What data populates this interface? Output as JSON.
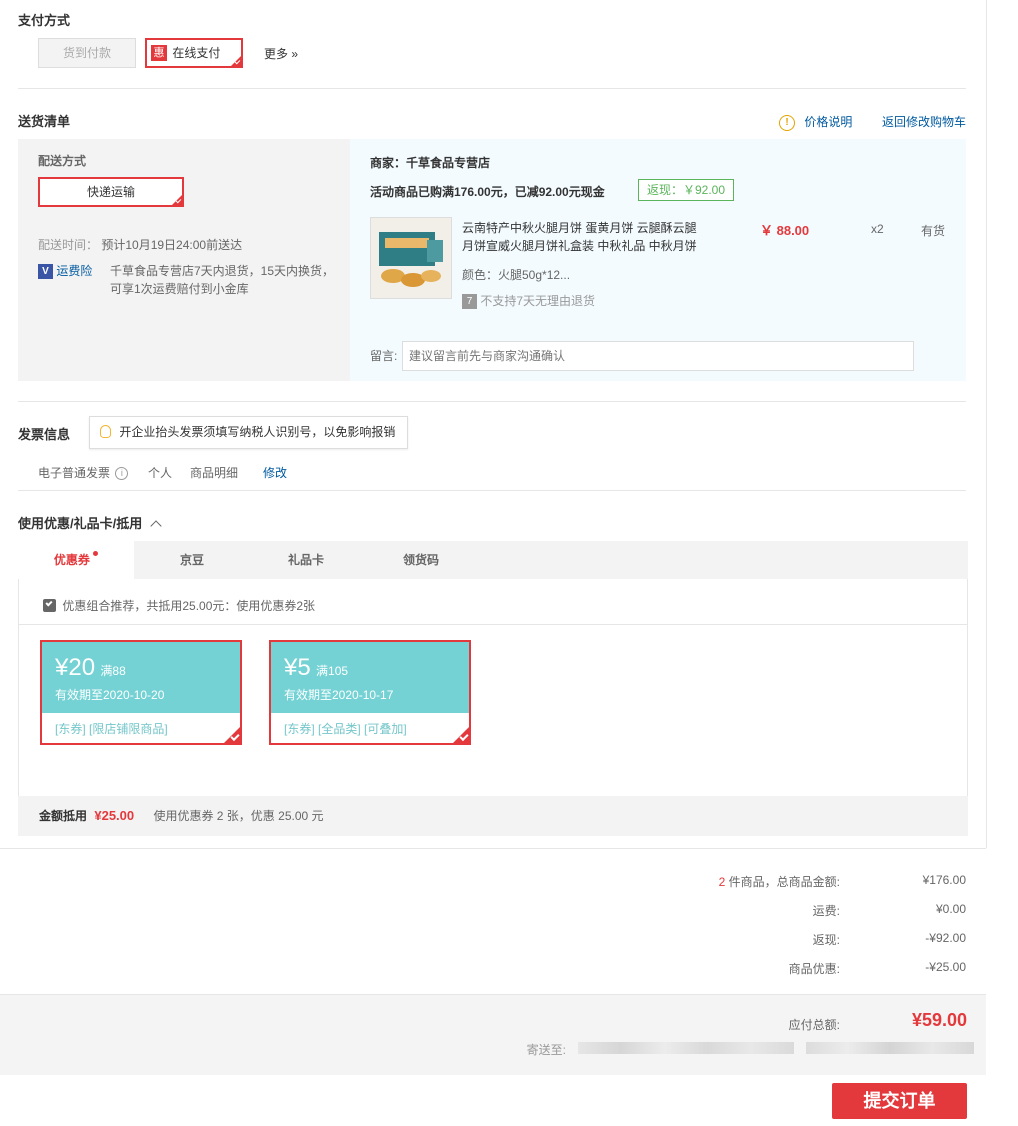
{
  "payment": {
    "title": "支付方式",
    "cod_label": "货到付款",
    "online_badge": "惠",
    "online_label": "在线支付",
    "more_label": "更多 »"
  },
  "delivery": {
    "title": "送货清单",
    "price_note": "价格说明",
    "back_to_cart": "返回修改购物车",
    "method_label": "配送方式",
    "method_value": "快递运输",
    "time_label": "配送时间：",
    "time_value": "预计10月19日24:00前送达",
    "insurance_label": "运费险",
    "insurance_text_1": "千草食品专营店7天内退货，15天内换货，",
    "insurance_text_2": "可享1次运费赔付到小金库"
  },
  "shop": {
    "seller": "商家：千草食品专营店",
    "promo": "活动商品已购满176.00元，已减92.00元现金",
    "cashback_badge": "返现：￥92.00",
    "product": {
      "name_line1": "云南特产中秋火腿月饼 蛋黄月饼 云腿酥云腿",
      "name_line2": "月饼宣威火腿月饼礼盒装 中秋礼品 中秋月饼",
      "spec": "颜色：火腿50g*12...",
      "return_note": "不支持7天无理由退货",
      "price": "￥ 88.00",
      "qty": "x2",
      "stock": "有货"
    },
    "message_label": "留言:",
    "message_placeholder": "建议留言前先与商家沟通确认"
  },
  "invoice": {
    "title": "发票信息",
    "tip": "开企业抬头发票须填写纳税人识别号，以免影响报销",
    "type": "电子普通发票",
    "header": "个人",
    "content": "商品明细",
    "edit": "修改"
  },
  "coupons": {
    "title": "使用优惠/礼品卡/抵用",
    "tabs": [
      "优惠券",
      "京豆",
      "礼品卡",
      "领货码"
    ],
    "recommend_text": "优惠组合推荐，共抵用25.00元：使用优惠券2张",
    "items": [
      {
        "amount": "¥20",
        "condition": "满88",
        "expiry": "有效期至2020-10-20",
        "tags": "[东券] [限店铺限商品]"
      },
      {
        "amount": "¥5",
        "condition": "满105",
        "expiry": "有效期至2020-10-17",
        "tags": "[东券] [全品类] [可叠加]"
      }
    ],
    "summary_label": "金额抵用",
    "summary_amount": "¥25.00",
    "summary_text": "使用优惠券 2 张，优惠 25.00 元"
  },
  "totals": {
    "count": "2",
    "count_suffix": " 件商品，总商品金额:",
    "goods_total": "¥176.00",
    "shipping_label": "运费:",
    "shipping_value": "¥0.00",
    "cashback_label": "返现:",
    "cashback_value": "-¥92.00",
    "discount_label": "商品优惠:",
    "discount_value": "-¥25.00",
    "payable_label": "应付总额:",
    "payable_value": "¥59.00",
    "ship_to_label": "寄送至:"
  },
  "submit_label": "提交订单",
  "colors": {
    "accent": "#e4393c",
    "link": "#005aa0",
    "coupon_teal": "#74d2d4",
    "panel_bg": "#f3f3f3",
    "shop_bg": "#f3fbfe"
  }
}
